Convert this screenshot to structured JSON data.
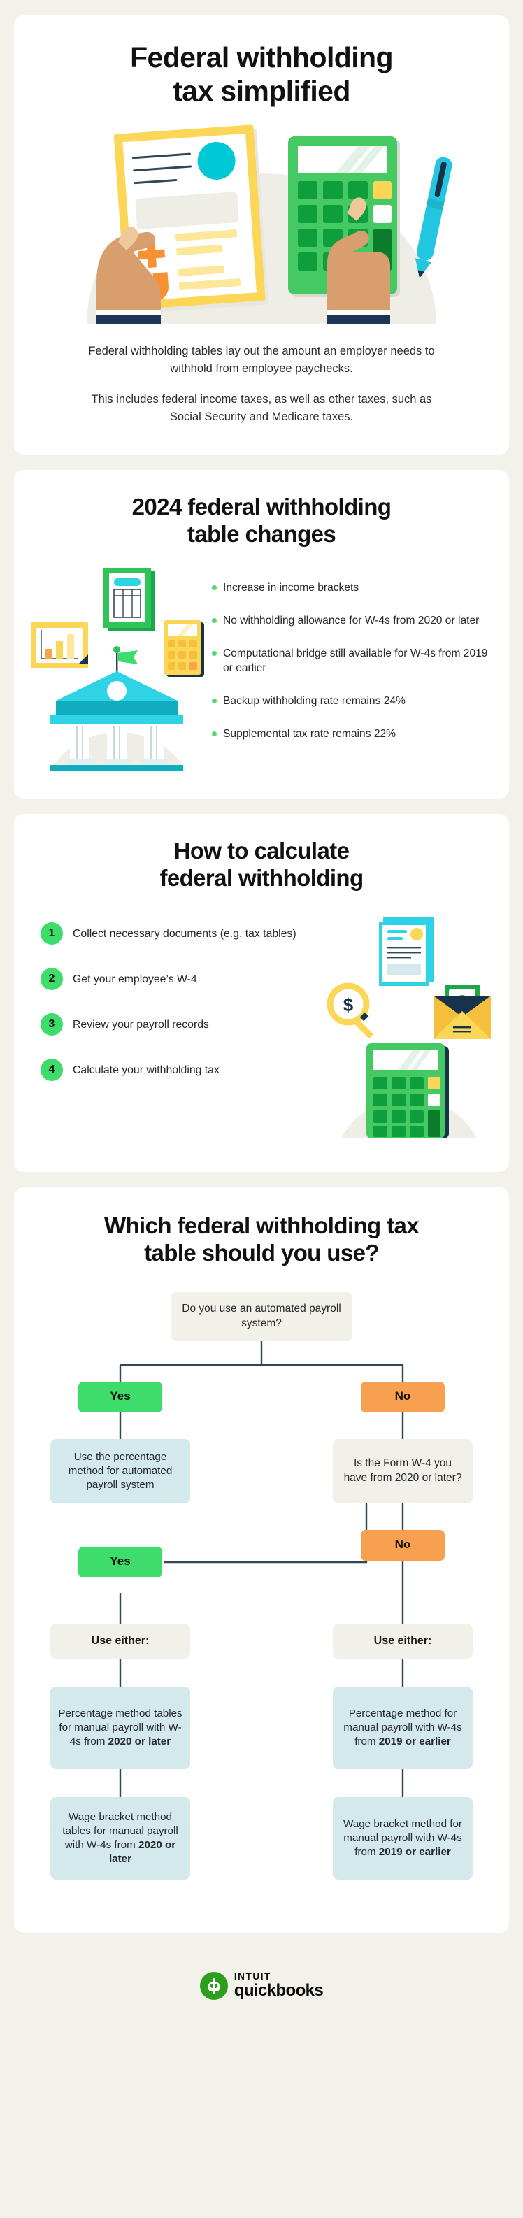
{
  "colors": {
    "page_background": "#f2f2eb",
    "card_background": "#ffffff",
    "green_accent": "#3ddc6b",
    "bullet_green": "#4ddb71",
    "orange_accent": "#f7a04f",
    "result_blue": "#d3e9ec",
    "neutral_box": "#f1f1e9",
    "line_navy": "#2f4858",
    "yellow": "#fcd757",
    "cyan": "#00c9d6",
    "calc_green": "#45c963",
    "skin": "#deab7f",
    "sleeve_navy": "#1d3557"
  },
  "hero": {
    "title": "Federal withholding\ntax simplified",
    "title_line1": "Federal withholding",
    "title_line2": "tax simplified",
    "illustration_name": "hands-holding-form-and-calculator",
    "paragraphs": [
      "Federal withholding tables lay out the amount an employer needs to withhold from employee paychecks.",
      "This includes federal income taxes, as well as other taxes, such as Social Security and Medicare taxes."
    ]
  },
  "changes": {
    "title_line1": "2024 federal withholding",
    "title_line2": "table changes",
    "illustration_name": "bank-building-with-chart-table-calculator",
    "bullets": [
      "Increase in income brackets",
      "No withholding allowance for W-4s from 2020 or later",
      "Computational bridge still available for W-4s from 2019 or earlier",
      "Backup withholding rate remains 24%",
      "Supplemental tax rate remains 22%"
    ]
  },
  "steps": {
    "title_line1": "How to calculate",
    "title_line2": "federal withholding",
    "illustration_name": "documents-magnifier-envelope-calculator",
    "items": [
      {
        "number": "1",
        "label": "Collect necessary documents (e.g. tax tables)"
      },
      {
        "number": "2",
        "label": "Get your employee’s W-4"
      },
      {
        "number": "3",
        "label": "Review your payroll records"
      },
      {
        "number": "4",
        "label": "Calculate your withholding tax"
      }
    ]
  },
  "flowchart": {
    "title_line1": "Which federal withholding tax",
    "title_line2": "table should you use?",
    "nodes": {
      "root_question": "Do you use an automated payroll system?",
      "branch1_yes": "Yes",
      "branch1_no": "No",
      "yes_result": "Use the percentage method for automated payroll system",
      "second_question": "Is the Form W-4 you have from 2020 or later?",
      "branch2_yes": "Yes",
      "branch2_no": "No",
      "left_use_either": "Use either:",
      "right_use_either": "Use either:",
      "left_percentage_pre": "Percentage method tables for manual payroll with W-4s from ",
      "left_percentage_bold": "2020 or later",
      "right_percentage_pre": "Percentage method for manual payroll with W-4s from ",
      "right_percentage_bold": "2019 or earlier",
      "left_wage_pre": "Wage bracket method tables for manual payroll with W-4s from ",
      "left_wage_bold": "2020 or later",
      "right_wage_pre": "Wage bracket method for manual payroll with W-4s from ",
      "right_wage_bold": "2019 or earlier"
    }
  },
  "footer": {
    "brand_mark": "quickbooks-qb-logo-icon",
    "intuit": "INTUIT",
    "quickbooks": "quickbooks"
  }
}
